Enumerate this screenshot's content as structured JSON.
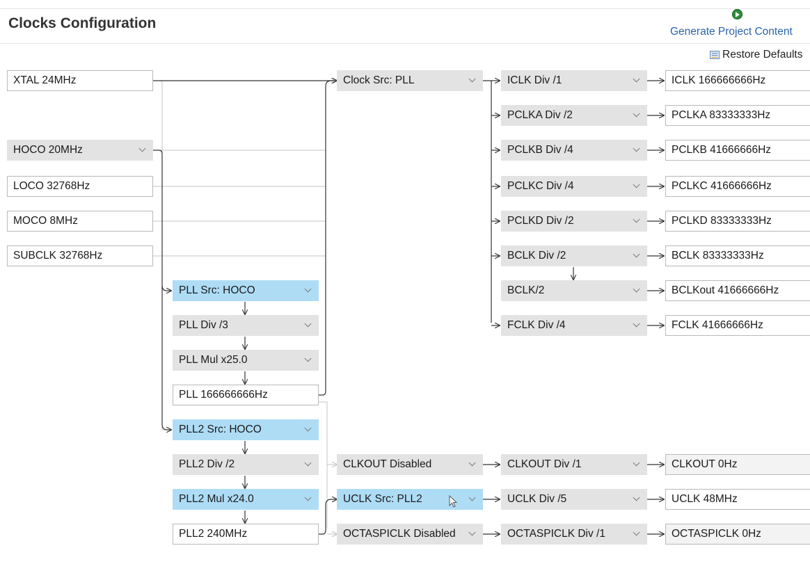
{
  "header": {
    "title": "Clocks Configuration",
    "generate_label": "Generate Project Content",
    "restore_label": "Restore Defaults"
  },
  "sources": {
    "xtal": "XTAL 24MHz",
    "hoco": "HOCO 20MHz",
    "loco": "LOCO 32768Hz",
    "moco": "MOCO 8MHz",
    "subclk": "SUBCLK 32768Hz"
  },
  "pll": {
    "src": "PLL Src: HOCO",
    "div": "PLL Div /3",
    "mul": "PLL Mul x25.0",
    "out": "PLL 166666666Hz"
  },
  "pll2": {
    "src": "PLL2 Src: HOCO",
    "div": "PLL2 Div /2",
    "mul": "PLL2 Mul x24.0",
    "out": "PLL2 240MHz"
  },
  "clock_src": "Clock Src: PLL",
  "dividers": {
    "iclk": "ICLK Div /1",
    "pclka": "PCLKA Div /2",
    "pclkb": "PCLKB Div /4",
    "pclkc": "PCLKC Div /4",
    "pclkd": "PCLKD Div /2",
    "bclk": "BCLK Div /2",
    "bclk2": "BCLK/2",
    "fclk": "FCLK Div /4"
  },
  "outputs": {
    "iclk": "ICLK 166666666Hz",
    "pclka": "PCLKA 83333333Hz",
    "pclkb": "PCLKB 41666666Hz",
    "pclkc": "PCLKC 41666666Hz",
    "pclkd": "PCLKD 83333333Hz",
    "bclk": "BCLK 83333333Hz",
    "bclkout": "BCLKout 41666666Hz",
    "fclk": "FCLK 41666666Hz"
  },
  "clkout": {
    "src": "CLKOUT Disabled",
    "div": "CLKOUT Div /1",
    "out": "CLKOUT 0Hz"
  },
  "uclk": {
    "src": "UCLK Src: PLL2",
    "div": "UCLK Div /5",
    "out": "UCLK 48MHz"
  },
  "octaspi": {
    "src": "OCTASPICLK Disabled",
    "div": "OCTASPICLK Div /1",
    "out": "OCTASPICLK 0Hz"
  },
  "colors": {
    "selected_highlight": "#aedcf5",
    "dropdown_bg": "#e3e3e3",
    "link": "#2a63a8",
    "generate_icon": "#2e8b3a"
  }
}
